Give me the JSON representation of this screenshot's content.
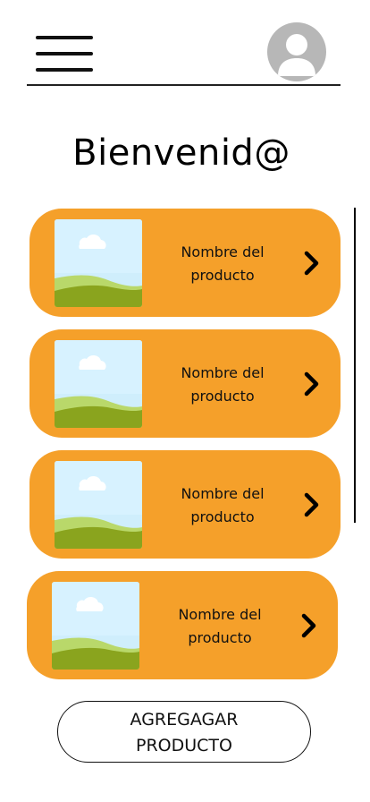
{
  "header": {
    "menu_icon": "hamburger-menu-icon",
    "avatar_icon": "user-avatar-icon"
  },
  "page": {
    "title": "Bienvenid@"
  },
  "products": [
    {
      "name": "Nombre del producto",
      "image_icon": "landscape-image-placeholder",
      "action_icon": "chevron-right-icon"
    },
    {
      "name": "Nombre del producto",
      "image_icon": "landscape-image-placeholder",
      "action_icon": "chevron-right-icon"
    },
    {
      "name": "Nombre del producto",
      "image_icon": "landscape-image-placeholder",
      "action_icon": "chevron-right-icon"
    },
    {
      "name": "Nombre del producto",
      "image_icon": "landscape-image-placeholder",
      "action_icon": "chevron-right-icon"
    }
  ],
  "actions": {
    "add_product_label": "AGREGAGAR PRODUCTO"
  },
  "colors": {
    "card_background": "#f5a02a",
    "avatar_gray": "#b7b7b7",
    "sky": "#cfeefc",
    "grass_light": "#b9d86a",
    "grass_dark": "#8aa41e"
  }
}
